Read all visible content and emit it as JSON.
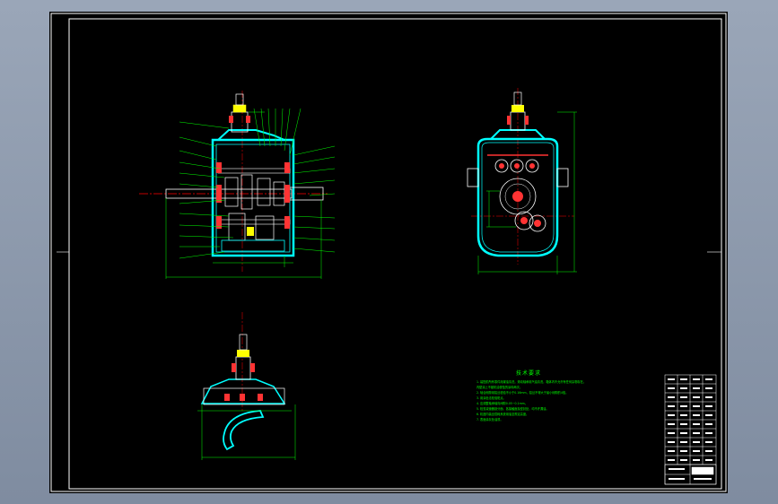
{
  "drawing": {
    "technical_requirements": {
      "title": "技术要求",
      "notes": [
        "1. 装配前所有零件用煤油清洗，滚动轴承用汽油清洗，箱体内不允许有任何杂物存在。",
        "   内壁涂上不被机油侵蚀的涂料两次。",
        "2. 啮合侧隙用铅丝检验不小于0.16mm，铅丝不得大于最小侧隙的4倍。",
        "3. 用涂色法检验斑点。",
        "4. 应调整轴承轴向间隙0.05~0.1mm。",
        "5. 检查减速器剖分面、各接触面及密封处，均不许漏油。",
        "6. 机座内装全损耗系统用油至规定高度。",
        "7. 表面涂灰色油漆。"
      ]
    },
    "colors": {
      "sheet_bg": "#000000",
      "frame": "#ffffff",
      "casing": "#00ffff",
      "dimension": "#00ff00",
      "center_line": "#ff0000",
      "part": "#ffffff",
      "hatch": "#ff3333"
    }
  }
}
